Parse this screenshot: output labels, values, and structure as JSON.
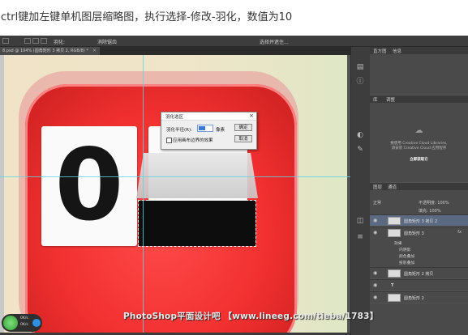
{
  "caption": "ctrl键加左键单机图层缩略图，执行选择-修改-羽化，数值为10",
  "options_bar": {
    "feather_label": "羽化:",
    "antialias_label": "消除锯齿",
    "select_mask_label": "选择并遮住..."
  },
  "document_tab": {
    "title": "8.psd @ 104% (圆角矩形 3 拷贝 2, RGB/8) *",
    "close": "×"
  },
  "dialog": {
    "title": "羽化选区",
    "radius_label": "羽化半径(R):",
    "radius_value": "10",
    "unit": "像素",
    "checkbox_label": "应用画布边界的效果",
    "ok": "确定",
    "cancel": "取消",
    "close": "×"
  },
  "canvas": {
    "digit": "0"
  },
  "panels": {
    "histogram_tabs": [
      "直方图",
      "信息"
    ],
    "adjust_tabs": [
      "库",
      "调整"
    ],
    "library_message": [
      "要使用 Creative Cloud Libraries,",
      "请安装 Creative Cloud 应用程序"
    ],
    "library_button": "立即获取它",
    "layers_tabs": [
      "图层",
      "通道"
    ],
    "blend_mode": "正常",
    "opacity_label": "不透明度: 100%",
    "fill_label": "填充: 100%",
    "layers": [
      {
        "name": "圆角矩形 3 拷贝 2",
        "active": true,
        "fx": false
      },
      {
        "name": "圆角矩形 3",
        "active": false,
        "fx": true
      },
      {
        "name": "圆角矩形 2 拷贝",
        "active": false,
        "fx": false
      },
      {
        "name": "T",
        "active": false,
        "fx": false
      },
      {
        "name": "圆角矩形 2",
        "active": false,
        "fx": false
      }
    ],
    "effects": [
      "效果",
      "内阴影",
      "颜色叠加",
      "投影叠加"
    ]
  },
  "badge": {
    "left_val": "0K/s",
    "right_val": "0K/s",
    "percent": "58"
  },
  "watermark": "PhotoShop平面设计吧 【www.lineeg.com/tieba/1783】",
  "colors": {
    "app_red": "#f23030",
    "guide": "#5fd3e5",
    "panel_bg": "#535353",
    "active_layer": "#5b6a80"
  }
}
